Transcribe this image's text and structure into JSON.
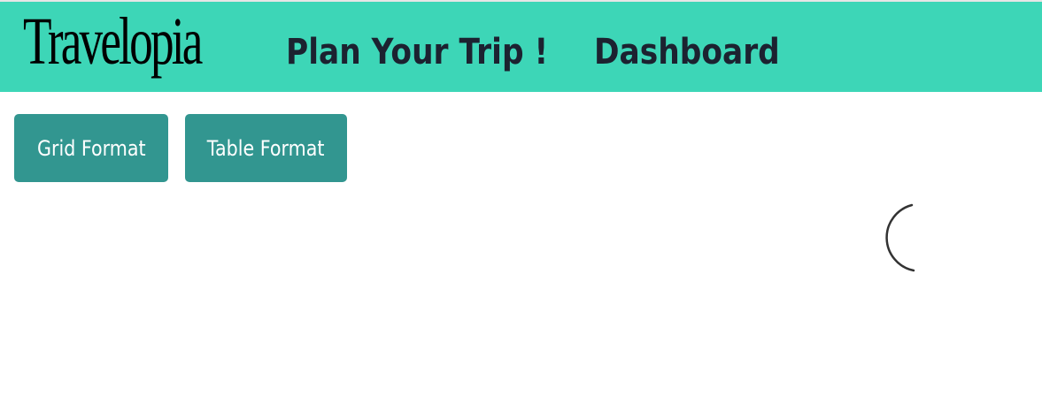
{
  "navbar": {
    "brand": "Travelopia",
    "links": [
      {
        "label": "Plan Your Trip !"
      },
      {
        "label": "Dashboard"
      }
    ],
    "background_color": "#3dd6b7"
  },
  "view_toggle": {
    "grid_label": "Grid Format",
    "table_label": "Table Format",
    "button_color": "#329690"
  },
  "loading": {
    "icon": "spinner-icon"
  }
}
